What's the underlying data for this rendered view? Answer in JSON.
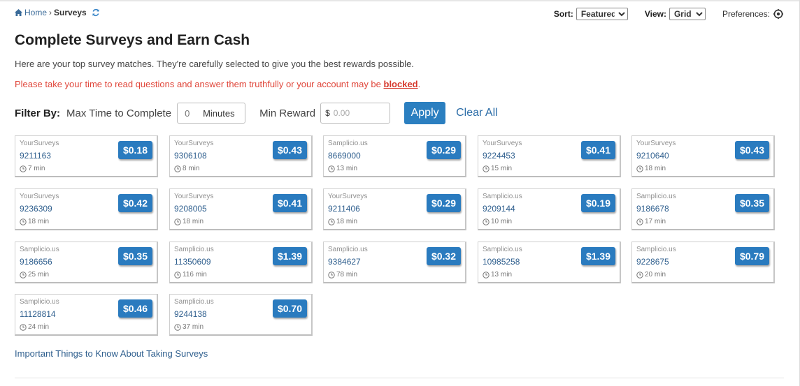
{
  "breadcrumb": {
    "home": "Home",
    "separator": "›",
    "current": "Surveys"
  },
  "controls": {
    "sort_label": "Sort:",
    "sort_value": "Featured",
    "view_label": "View:",
    "view_value": "Grid",
    "preferences_label": "Preferences:"
  },
  "page": {
    "title": "Complete Surveys and Earn Cash",
    "subtitle": "Here are your top survey matches. They're carefully selected to give you the best rewards possible.",
    "warning_prefix": "Please take your time to read questions and answer them truthfully or your account may be ",
    "warning_link": "blocked",
    "warning_suffix": "."
  },
  "filter": {
    "label": "Filter By:",
    "max_time_label": "Max Time to Complete",
    "max_time_value": "0",
    "max_time_unit": "Minutes",
    "min_reward_label": "Min Reward",
    "currency": "$",
    "min_reward_placeholder": "0.00",
    "apply": "Apply",
    "clear": "Clear All"
  },
  "surveys": [
    {
      "provider": "YourSurveys",
      "id": "9211163",
      "time": "7 min",
      "reward": "$0.18"
    },
    {
      "provider": "YourSurveys",
      "id": "9306108",
      "time": "8 min",
      "reward": "$0.43"
    },
    {
      "provider": "Samplicio.us",
      "id": "8669000",
      "time": "13 min",
      "reward": "$0.29"
    },
    {
      "provider": "YourSurveys",
      "id": "9224453",
      "time": "15 min",
      "reward": "$0.41"
    },
    {
      "provider": "YourSurveys",
      "id": "9210640",
      "time": "18 min",
      "reward": "$0.43"
    },
    {
      "provider": "YourSurveys",
      "id": "9236309",
      "time": "18 min",
      "reward": "$0.42"
    },
    {
      "provider": "YourSurveys",
      "id": "9208005",
      "time": "18 min",
      "reward": "$0.41"
    },
    {
      "provider": "YourSurveys",
      "id": "9211406",
      "time": "18 min",
      "reward": "$0.29"
    },
    {
      "provider": "Samplicio.us",
      "id": "9209144",
      "time": "10 min",
      "reward": "$0.19"
    },
    {
      "provider": "Samplicio.us",
      "id": "9186678",
      "time": "17 min",
      "reward": "$0.35"
    },
    {
      "provider": "Samplicio.us",
      "id": "9186656",
      "time": "25 min",
      "reward": "$0.35"
    },
    {
      "provider": "Samplicio.us",
      "id": "11350609",
      "time": "116 min",
      "reward": "$1.39"
    },
    {
      "provider": "Samplicio.us",
      "id": "9384627",
      "time": "78 min",
      "reward": "$0.32"
    },
    {
      "provider": "Samplicio.us",
      "id": "10985258",
      "time": "13 min",
      "reward": "$1.39"
    },
    {
      "provider": "Samplicio.us",
      "id": "9228675",
      "time": "20 min",
      "reward": "$0.79"
    },
    {
      "provider": "Samplicio.us",
      "id": "11128814",
      "time": "24 min",
      "reward": "$0.46"
    },
    {
      "provider": "Samplicio.us",
      "id": "9244138",
      "time": "37 min",
      "reward": "$0.70"
    }
  ],
  "footer_link": "Important Things to Know About Taking Surveys",
  "colors": {
    "accent": "#2a7bbf",
    "link": "#2f5f8e",
    "warning": "#e0463a"
  },
  "icons": {
    "home": "home-icon",
    "refresh": "refresh-icon",
    "preferences": "gear-icon",
    "time": "clock-icon"
  }
}
